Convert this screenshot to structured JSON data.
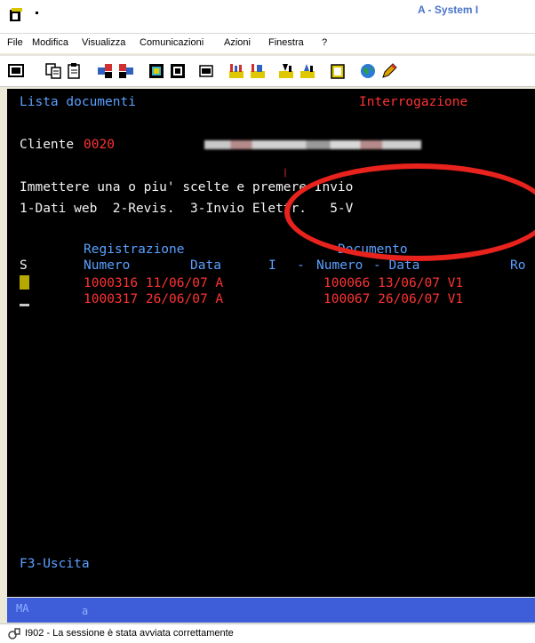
{
  "window": {
    "title": "A - System I"
  },
  "menu": [
    {
      "label": "File"
    },
    {
      "label": "Modifica"
    },
    {
      "label": "Visualizza"
    },
    {
      "label": "Comunicazioni"
    },
    {
      "label": "Azioni"
    },
    {
      "label": "Finestra"
    },
    {
      "label": "?"
    }
  ],
  "toolbar": {
    "buttons": [
      "display-icon",
      "copy-icon",
      "paste-icon",
      "send-icon",
      "receive-icon",
      "screen-icon",
      "screen-alt-icon",
      "print-icon",
      "macro-record-icon",
      "macro-play-icon",
      "transfer-up-icon",
      "transfer-down-icon",
      "clipboard-icon",
      "globe-icon",
      "edit-icon"
    ]
  },
  "terminal": {
    "screen_title": "Lista documenti",
    "mode": "Interrogazione",
    "client_label": "Cliente",
    "client_code": "0020",
    "instruction": "Immettere una o piu' scelte e premere Invio",
    "options": "1-Dati web  2-Revis.  3-Invio Elettr.   5-V",
    "header_registrazione": "Registrazione",
    "header_documento": "Documento",
    "col_s": "S",
    "col_numero": "Numero",
    "col_data": "Data",
    "col_i": "I",
    "col_dash1": "-",
    "col_doc_numero": "Numero",
    "col_dash2": "- Data",
    "col_r": "Ro",
    "rows": [
      {
        "reg": "1000316 11/06/07 A",
        "doc": "100066 13/06/07 V1"
      },
      {
        "reg": "1000317 26/06/07 A",
        "doc": "100067 26/06/07 V1"
      }
    ],
    "function_key": "F3-Uscita"
  },
  "oia": {
    "left": "MA",
    "mid": "a"
  },
  "status": {
    "message": "I902 - La sessione è stata avviata correttamente"
  },
  "colors": {
    "terminal_bg": "#000000",
    "field_blue": "#5aa0ff",
    "data_red": "#ff3333",
    "annotation_red": "#e8221c",
    "oia_bar": "#3d5ed8"
  }
}
